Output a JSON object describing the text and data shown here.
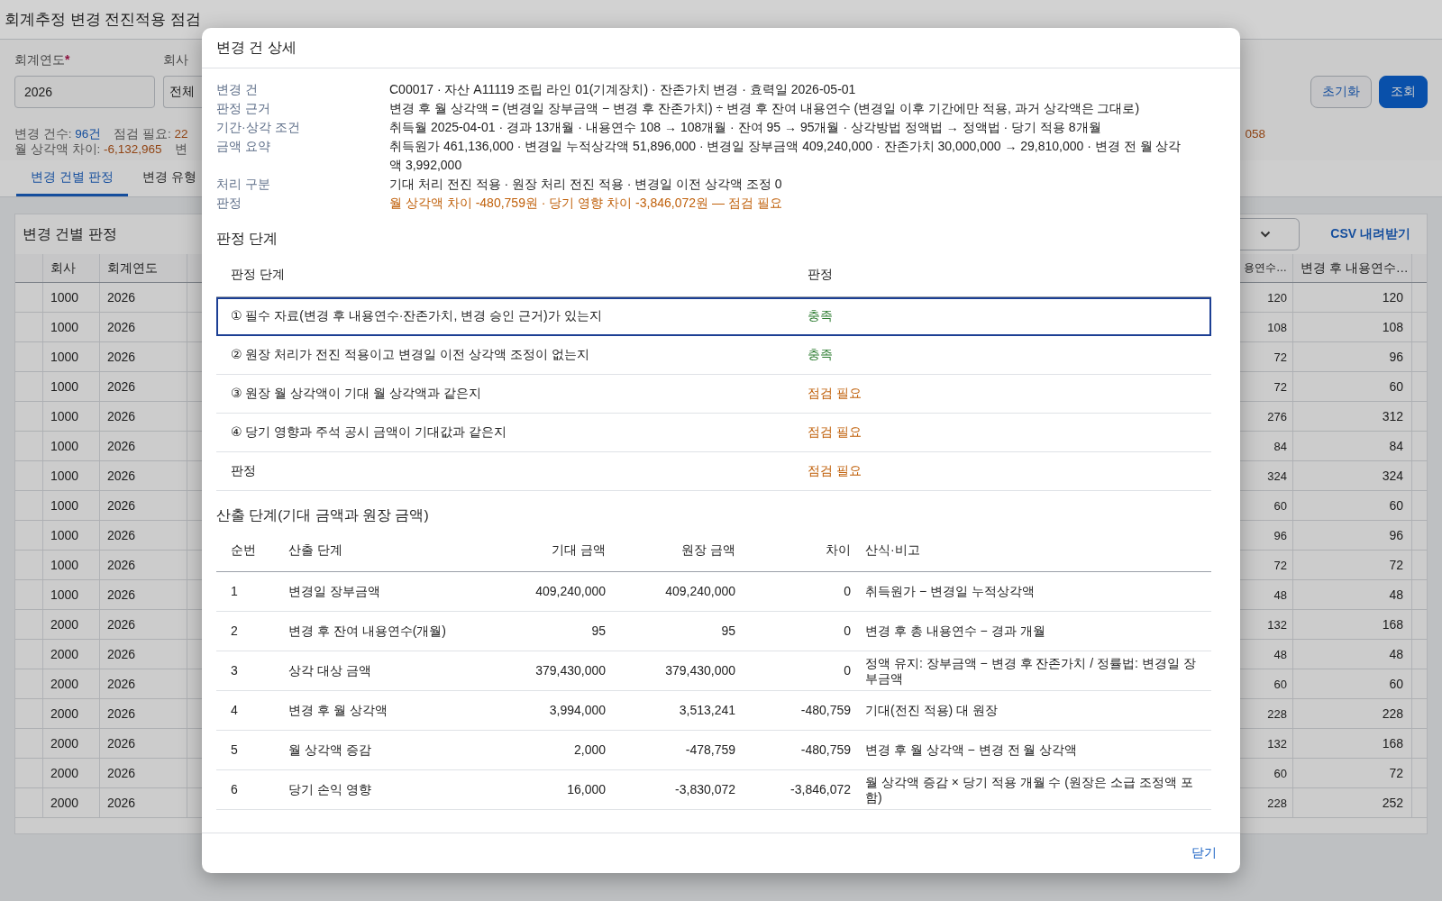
{
  "page_title": "회계추정 변경 전진적용 점검",
  "filters": [
    {
      "kind": "input",
      "label": "회계연도",
      "required_mark": "*",
      "value": "2026"
    },
    {
      "kind": "select",
      "label": "회사",
      "value": "전체"
    }
  ],
  "actions": [
    {
      "label": "초기화",
      "primary": false
    },
    {
      "label": "조회",
      "primary": true
    }
  ],
  "summary": {
    "lines": [
      [
        {
          "label": "변경 건수:",
          "value": "96건",
          "color": "#154e9d"
        },
        {
          "label": "점검 필요:",
          "value": "22",
          "color": "#914515"
        }
      ],
      [
        {
          "label": "월 상각액 차이:",
          "value": "-6,132,965",
          "color": "#914515"
        },
        {
          "label": "변"
        }
      ]
    ],
    "trailing": "058"
  },
  "tabs": [
    {
      "label": "변경 건별 판정",
      "selected": true
    },
    {
      "label": "변경 유형",
      "selected": false
    }
  ],
  "card": {
    "title": "변경 건별 판정",
    "download_link": "CSV 내려받기",
    "table": {
      "columns_left": [
        "회사",
        "회계연도"
      ],
      "columns_right": [
        "용연수…",
        "변경 후 내용연수…"
      ],
      "rows": [
        {
          "company": "1000",
          "fiscal_year": "2026",
          "column_a": "120",
          "column_b": "120"
        },
        {
          "company": "1000",
          "fiscal_year": "2026",
          "column_a": "108",
          "column_b": "108"
        },
        {
          "company": "1000",
          "fiscal_year": "2026",
          "column_a": "72",
          "column_b": "96"
        },
        {
          "company": "1000",
          "fiscal_year": "2026",
          "column_a": "72",
          "column_b": "60"
        },
        {
          "company": "1000",
          "fiscal_year": "2026",
          "column_a": "276",
          "column_b": "312"
        },
        {
          "company": "1000",
          "fiscal_year": "2026",
          "column_a": "84",
          "column_b": "84"
        },
        {
          "company": "1000",
          "fiscal_year": "2026",
          "column_a": "324",
          "column_b": "324"
        },
        {
          "company": "1000",
          "fiscal_year": "2026",
          "column_a": "60",
          "column_b": "60"
        },
        {
          "company": "1000",
          "fiscal_year": "2026",
          "column_a": "96",
          "column_b": "96"
        },
        {
          "company": "1000",
          "fiscal_year": "2026",
          "column_a": "72",
          "column_b": "72"
        },
        {
          "company": "1000",
          "fiscal_year": "2026",
          "column_a": "48",
          "column_b": "48"
        },
        {
          "company": "2000",
          "fiscal_year": "2026",
          "column_a": "132",
          "column_b": "168"
        },
        {
          "company": "2000",
          "fiscal_year": "2026",
          "column_a": "48",
          "column_b": "48"
        },
        {
          "company": "2000",
          "fiscal_year": "2026",
          "column_a": "60",
          "column_b": "60"
        },
        {
          "company": "2000",
          "fiscal_year": "2026",
          "column_a": "228",
          "column_b": "228"
        },
        {
          "company": "2000",
          "fiscal_year": "2026",
          "column_a": "132",
          "column_b": "168"
        },
        {
          "company": "2000",
          "fiscal_year": "2026",
          "column_a": "60",
          "column_b": "72"
        },
        {
          "company": "2000",
          "fiscal_year": "2026",
          "column_a": "228",
          "column_b": "252"
        }
      ]
    }
  },
  "modal": {
    "title": "변경 건 상세",
    "info": [
      {
        "label": "변경 건",
        "value": "C00017 · 자산 A11119 조립 라인 01(기계장치) · 잔존가치 변경 · 효력일 2026-05-01",
        "color": "#222222"
      },
      {
        "label": "판정 근거",
        "value": "변경 후 월 상각액 = (변경일 장부금액 − 변경 후 잔존가치) ÷ 변경 후 잔여 내용연수 (변경일 이후 기간에만 적용, 과거 상각액은 그대로)",
        "color": "#222222"
      },
      {
        "label": "기간·상각 조건",
        "value": "취득월 2025-04-01 · 경과 13개월 · 내용연수 108 → 108개월 · 잔여 95 → 95개월 · 상각방법 정액법 → 정액법 · 당기 적용 8개월",
        "color": "#222222"
      },
      {
        "label": "금액 요약",
        "value": "취득원가 461,136,000 · 변경일 누적상각액 51,896,000 · 변경일 장부금액 409,240,000 · 잔존가치 30,000,000 → 29,810,000 · 변경 전 월 상각액 3,992,000",
        "color": "#222222"
      },
      {
        "label": "처리 구분",
        "value": "기대 처리 전진 적용 · 원장 처리 전진 적용 · 변경일 이전 상각액 조정 0",
        "color": "#222222"
      },
      {
        "label": "판정",
        "value": "월 상각액 차이 -480,759원 · 당기 영향 차이 -3,846,072원 — 점검 필요",
        "color": "#c0600a"
      }
    ],
    "judgement": {
      "title": "판정 단계",
      "columns": [
        "판정 단계",
        "판정"
      ],
      "steps": [
        {
          "label": "① 필수 자료(변경 후 내용연수·잔존가치, 변경 승인 근거)가 있는지",
          "verdict": "충족",
          "color": "#2e7d32",
          "selected": true
        },
        {
          "label": "② 원장 처리가 전진 적용이고 변경일 이전 상각액 조정이 없는지",
          "verdict": "충족",
          "color": "#2e7d32",
          "selected": false
        },
        {
          "label": "③ 원장 월 상각액이 기대 월 상각액과 같은지",
          "verdict": "점검 필요",
          "color": "#c0600a",
          "selected": false
        },
        {
          "label": "④ 당기 영향과 주석 공시 금액이 기대값과 같은지",
          "verdict": "점검 필요",
          "color": "#c0600a",
          "selected": false
        },
        {
          "label": "판정",
          "verdict": "점검 필요",
          "color": "#c0600a",
          "selected": false
        }
      ]
    },
    "calculation": {
      "title": "산출 단계(기대 금액과 원장 금액)",
      "columns": [
        "순번",
        "산출 단계",
        "기대 금액",
        "원장 금액",
        "차이",
        "산식·비고"
      ],
      "rows": [
        {
          "no": "1",
          "step": "변경일 장부금액",
          "expected": "409,240,000",
          "ledger": "409,240,000",
          "difference": "0",
          "note": "취득원가 − 변경일 누적상각액"
        },
        {
          "no": "2",
          "step": "변경 후 잔여 내용연수(개월)",
          "expected": "95",
          "ledger": "95",
          "difference": "0",
          "note": "변경 후 총 내용연수 − 경과 개월"
        },
        {
          "no": "3",
          "step": "상각 대상 금액",
          "expected": "379,430,000",
          "ledger": "379,430,000",
          "difference": "0",
          "note": "정액 유지: 장부금액 − 변경 후 잔존가치 / 정률법: 변경일 장부금액"
        },
        {
          "no": "4",
          "step": "변경 후 월 상각액",
          "expected": "3,994,000",
          "ledger": "3,513,241",
          "difference": "-480,759",
          "note": "기대(전진 적용) 대 원장"
        },
        {
          "no": "5",
          "step": "월 상각액 증감",
          "expected": "2,000",
          "ledger": "-478,759",
          "difference": "-480,759",
          "note": "변경 후 월 상각액 − 변경 전 월 상각액"
        },
        {
          "no": "6",
          "step": "당기 손익 영향",
          "expected": "16,000",
          "ledger": "-3,830,072",
          "difference": "-3,846,072",
          "note": "월 상각액 증감 × 당기 적용 개월 수 (원장은 소급 조정액 포함)"
        }
      ]
    },
    "close": "닫기"
  }
}
